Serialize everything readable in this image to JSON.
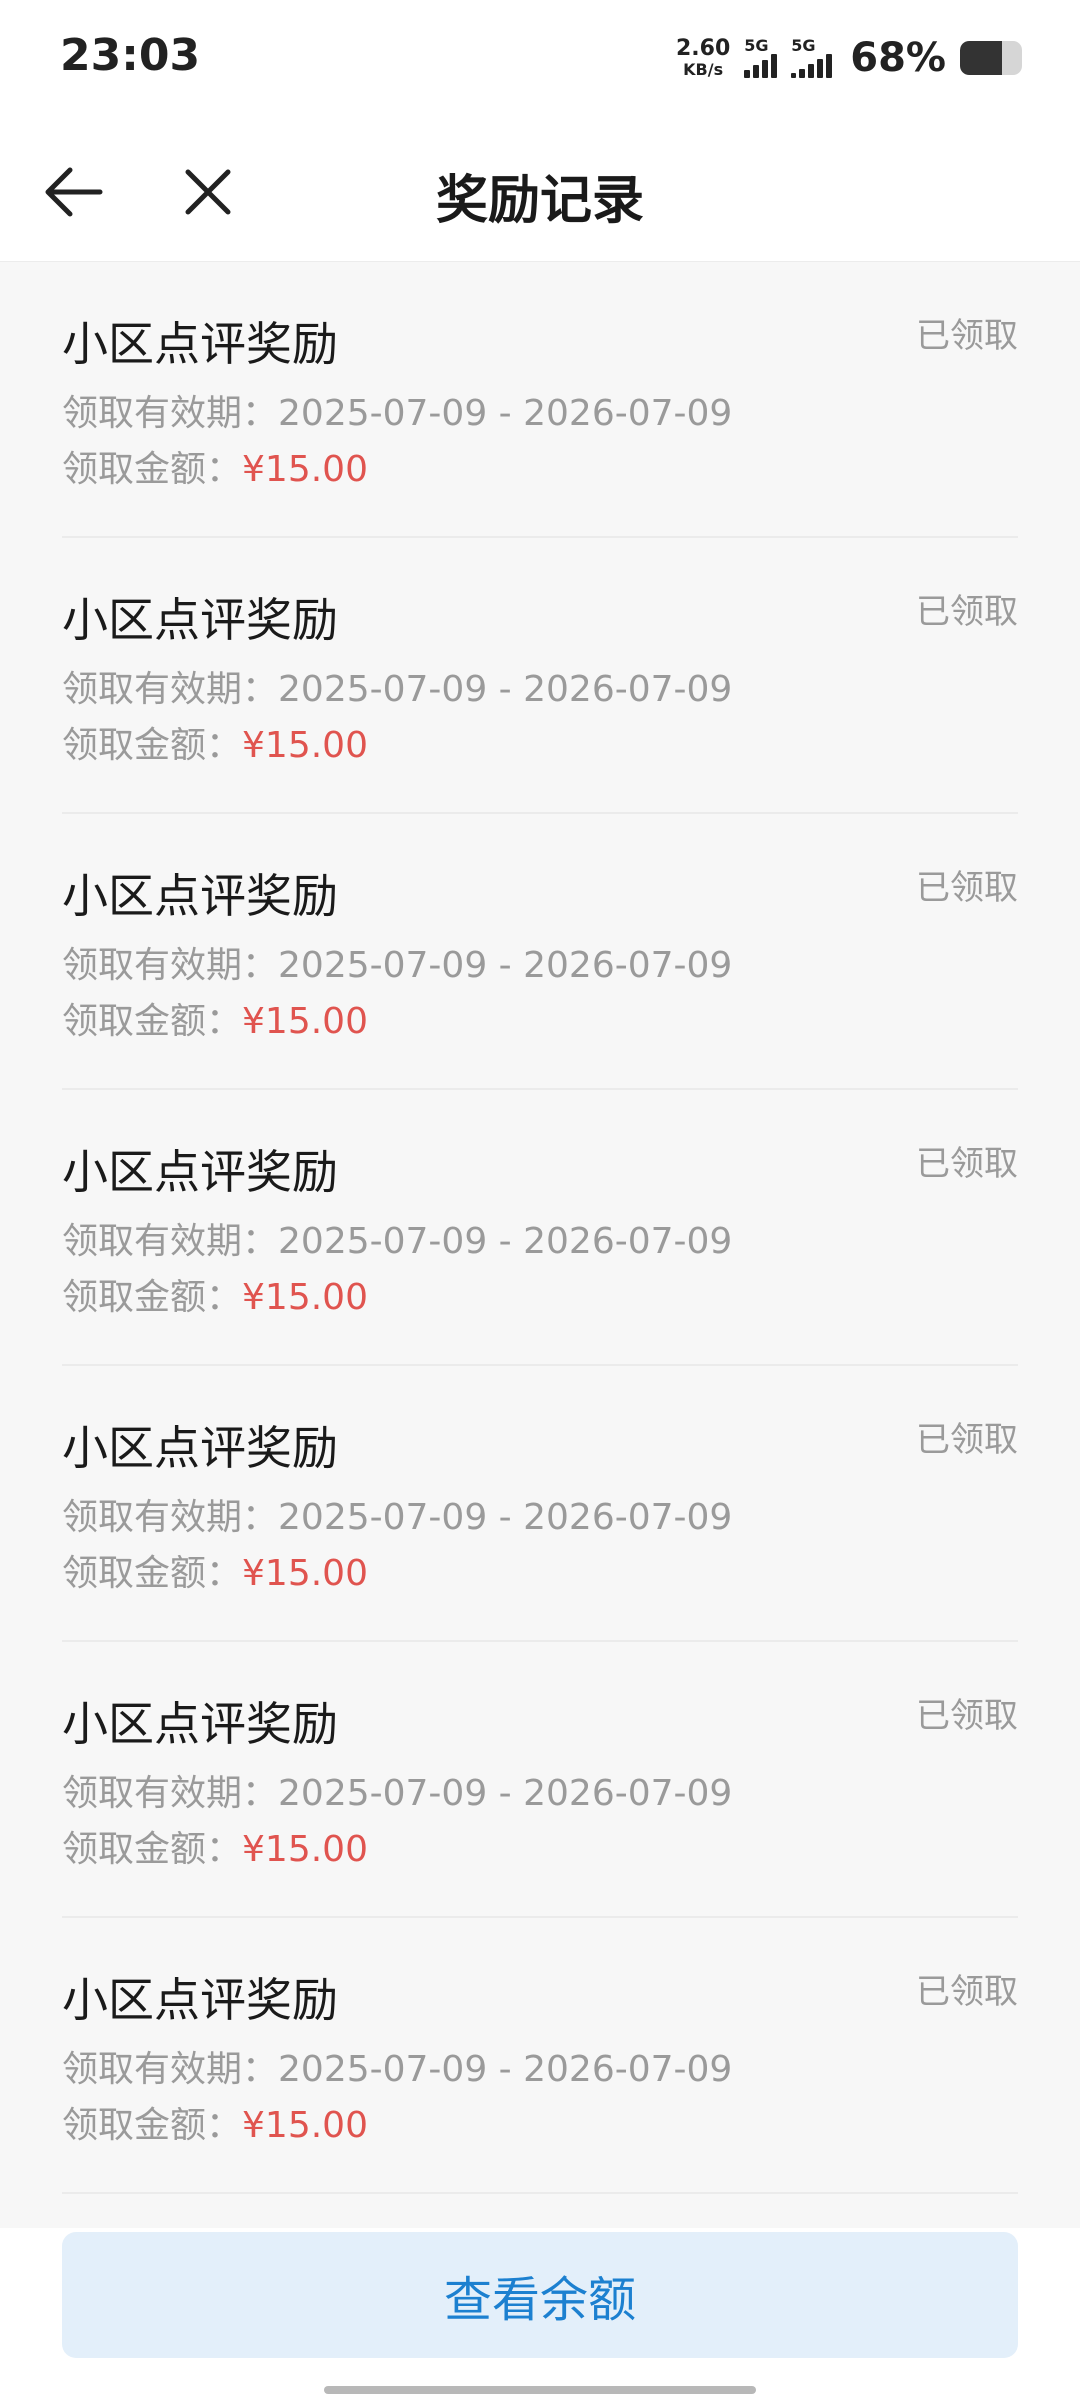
{
  "status_bar": {
    "time": "23:03",
    "net_speed_value": "2.60",
    "net_speed_unit": "KB/s",
    "sim1_label": "5G",
    "sim2_label": "5G",
    "battery_percent": "68%",
    "battery_level": 0.68
  },
  "header": {
    "title": "奖励记录",
    "back_icon": "arrow-left-icon",
    "close_icon": "close-icon"
  },
  "records": [
    {
      "title": "小区点评奖励",
      "status": "已领取",
      "validity_label": "领取有效期：",
      "validity": "2025-07-09 - 2026-07-09",
      "amount_label": "领取金额：",
      "amount": "¥15.00"
    },
    {
      "title": "小区点评奖励",
      "status": "已领取",
      "validity_label": "领取有效期：",
      "validity": "2025-07-09 - 2026-07-09",
      "amount_label": "领取金额：",
      "amount": "¥15.00"
    },
    {
      "title": "小区点评奖励",
      "status": "已领取",
      "validity_label": "领取有效期：",
      "validity": "2025-07-09 - 2026-07-09",
      "amount_label": "领取金额：",
      "amount": "¥15.00"
    },
    {
      "title": "小区点评奖励",
      "status": "已领取",
      "validity_label": "领取有效期：",
      "validity": "2025-07-09 - 2026-07-09",
      "amount_label": "领取金额：",
      "amount": "¥15.00"
    },
    {
      "title": "小区点评奖励",
      "status": "已领取",
      "validity_label": "领取有效期：",
      "validity": "2025-07-09 - 2026-07-09",
      "amount_label": "领取金额：",
      "amount": "¥15.00"
    },
    {
      "title": "小区点评奖励",
      "status": "已领取",
      "validity_label": "领取有效期：",
      "validity": "2025-07-09 - 2026-07-09",
      "amount_label": "领取金额：",
      "amount": "¥15.00"
    },
    {
      "title": "小区点评奖励",
      "status": "已领取",
      "validity_label": "领取有效期：",
      "validity": "2025-07-09 - 2026-07-09",
      "amount_label": "领取金额：",
      "amount": "¥15.00"
    }
  ],
  "footer": {
    "balance_button": "查看余额"
  },
  "colors": {
    "amount": "#e0544f",
    "button_bg": "#e3effa",
    "button_text": "#1c80d0"
  }
}
